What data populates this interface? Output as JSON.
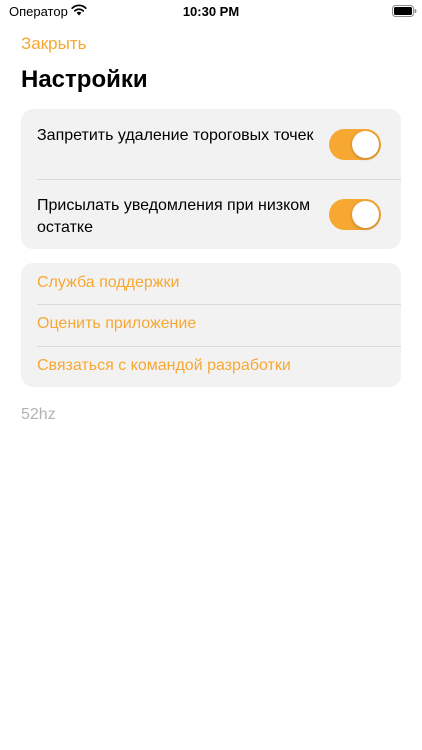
{
  "status_bar": {
    "carrier": "Оператор",
    "time": "10:30 PM",
    "wifi_icon": "wifi-icon",
    "battery_icon": "battery-icon"
  },
  "header": {
    "close_label": "Закрыть",
    "title": "Настройки"
  },
  "settings": {
    "toggles": [
      {
        "label": "Запретить удаление тороговых точек",
        "on": true
      },
      {
        "label": "Присылать уведомления при низком остатке",
        "on": true
      }
    ]
  },
  "links": [
    {
      "label": "Служба поддержки"
    },
    {
      "label": "Оценить приложение"
    },
    {
      "label": "Связаться с командой разработки"
    }
  ],
  "footer": {
    "version": "52hz"
  },
  "colors": {
    "accent": "#f6a833",
    "group_background": "#f2f2f3",
    "separator": "#d9d9db",
    "muted_text": "#b3b3b3"
  }
}
